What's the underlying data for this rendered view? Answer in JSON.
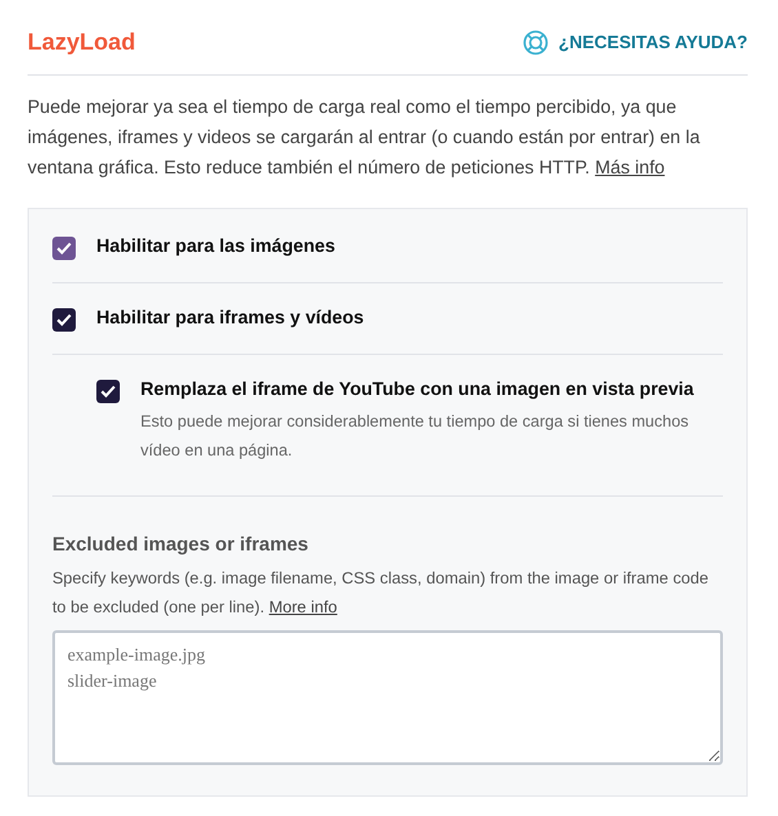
{
  "header": {
    "title": "LazyLoad",
    "help_link": "¿NECESITAS AYUDA?"
  },
  "intro": {
    "text": "Puede mejorar ya sea el tiempo de carga real como el tiempo percibido, ya que imágenes, iframes y videos se cargarán al entrar (o cuando están por entrar) en la ventana gráfica. Esto reduce también el número de peticiones HTTP.",
    "link": "Más info"
  },
  "options": [
    {
      "label": "Habilitar para las imágenes",
      "checked": true,
      "color": "#6e5494"
    },
    {
      "label": "Habilitar para iframes y vídeos",
      "checked": true,
      "color": "#1f1a3d",
      "children": [
        {
          "label": "Remplaza el iframe de YouTube con una imagen en vista previa",
          "description": "Esto puede mejorar considerablemente tu tiempo de carga si tienes muchos vídeo en una página.",
          "checked": true,
          "color": "#1f1a3d"
        }
      ]
    }
  ],
  "exclusions": {
    "title": "Excluded images or iframes",
    "description": "Specify keywords (e.g. image filename, CSS class, domain) from the image or iframe code to be excluded (one per line).",
    "link": "More info",
    "placeholder": "example-image.jpg\nslider-image"
  }
}
